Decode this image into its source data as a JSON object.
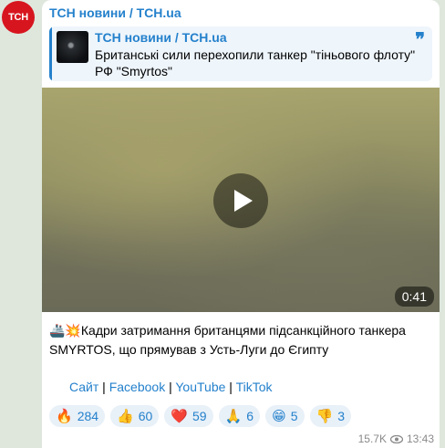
{
  "channel": {
    "avatar_text": "ТСН",
    "name": "ТСН новини / TCH.ua"
  },
  "reply": {
    "title": "ТСН новини / TCH.ua",
    "text": "Британські сили перехопили танкер \"тіньового флоту\" РФ \"Smyrtos\"",
    "quote_icon": "quote-icon"
  },
  "video": {
    "duration": "0:41",
    "play_icon": "play-icon"
  },
  "caption": {
    "emoji": "🚢💥",
    "text": "Кадри затримання британцями підсанкційного танкера SMYRTOS, що прямував з Усть-Луги до Єгипту"
  },
  "links": [
    {
      "label": "Сайт"
    },
    {
      "label": "Facebook"
    },
    {
      "label": "YouTube"
    },
    {
      "label": "TikTok"
    }
  ],
  "links_separator": " | ",
  "reactions": [
    {
      "emoji": "🔥",
      "count": "284",
      "icon": "fire-icon"
    },
    {
      "emoji": "👍",
      "count": "60",
      "icon": "thumbs-up-icon"
    },
    {
      "emoji": "❤️",
      "count": "59",
      "icon": "heart-icon"
    },
    {
      "emoji": "🙏",
      "count": "6",
      "icon": "pray-icon"
    },
    {
      "emoji": "😁",
      "count": "5",
      "icon": "grin-icon"
    },
    {
      "emoji": "👎",
      "count": "3",
      "icon": "thumbs-down-icon"
    }
  ],
  "meta": {
    "views": "15.7K",
    "time": "13:43",
    "views_icon": "eye-icon"
  },
  "colors": {
    "accent": "#2481cc",
    "avatar_bg": "#d7151f",
    "chat_bg": "#dfe7dd"
  }
}
